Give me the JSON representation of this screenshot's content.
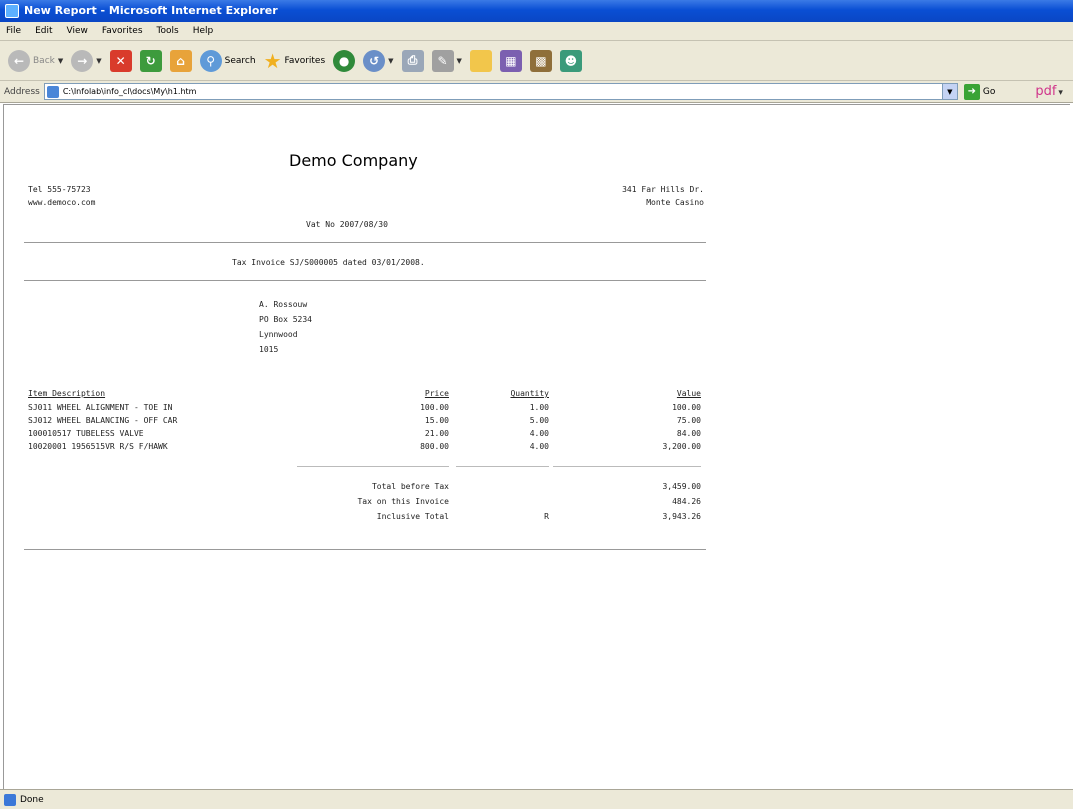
{
  "window": {
    "title": "New Report - Microsoft Internet Explorer"
  },
  "menu": {
    "items": [
      "File",
      "Edit",
      "View",
      "Favorites",
      "Tools",
      "Help"
    ]
  },
  "toolbar": {
    "back_label": "Back",
    "search_label": "Search",
    "favorites_label": "Favorites"
  },
  "address": {
    "label": "Address",
    "url": "C:\\Infolab\\info_cl\\docs\\My\\h1.htm",
    "go_label": "Go",
    "pdf_label": "pdf"
  },
  "report": {
    "company": "Demo Company",
    "tel": "Tel 555-75723",
    "web": "www.democo.com",
    "address_line1": "341 Far Hills Dr.",
    "address_line2": "Monte Casino",
    "vat": "Vat No 2007/08/30",
    "invoice_line": "Tax Invoice SJ/S000005 dated 03/01/2008.",
    "customer": [
      "A. Rossouw",
      "PO Box 5234",
      "Lynnwood",
      "1015"
    ],
    "headers": {
      "description": "Item Description",
      "price": "Price",
      "quantity": "Quantity",
      "value": "Value"
    },
    "items": [
      {
        "description": "SJ011 WHEEL ALIGNMENT - TOE IN",
        "price": "100.00",
        "quantity": "1.00",
        "value": "100.00"
      },
      {
        "description": "SJ012 WHEEL BALANCING - OFF CAR",
        "price": "15.00",
        "quantity": "5.00",
        "value": "75.00"
      },
      {
        "description": "100010517 TUBELESS VALVE",
        "price": "21.00",
        "quantity": "4.00",
        "value": "84.00"
      },
      {
        "description": "10020001 1956515VR R/S F/HAWK",
        "price": "800.00",
        "quantity": "4.00",
        "value": "3,200.00"
      }
    ],
    "totals": [
      {
        "label": "Total before Tax",
        "currency": "",
        "value": "3,459.00"
      },
      {
        "label": "Tax on this Invoice",
        "currency": "",
        "value": "484.26"
      },
      {
        "label": "Inclusive Total",
        "currency": "R",
        "value": "3,943.26"
      }
    ]
  },
  "status": {
    "text": "Done"
  }
}
